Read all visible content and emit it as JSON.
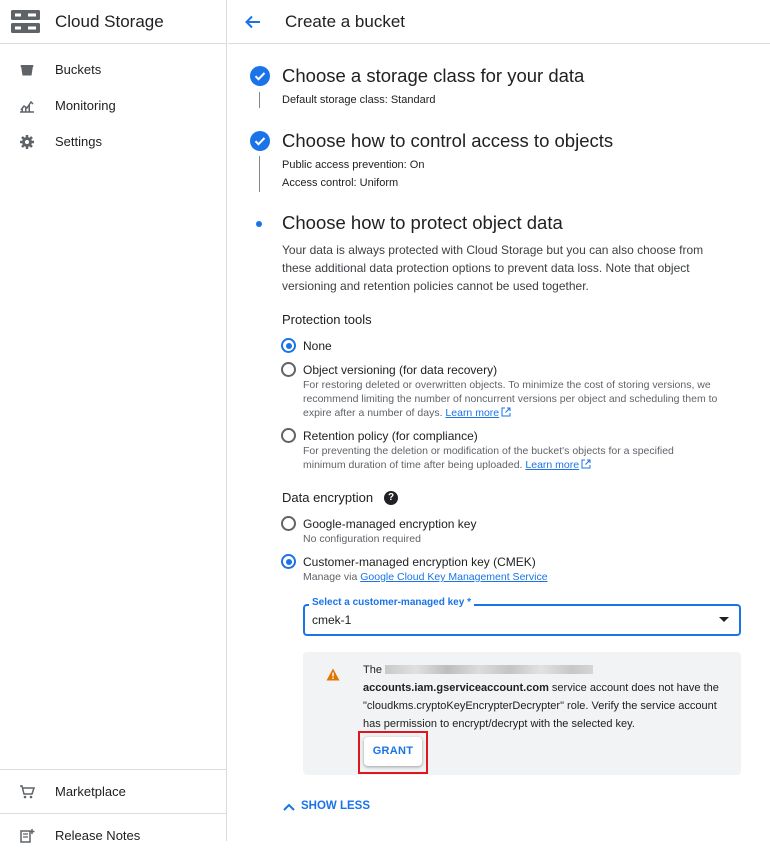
{
  "sidebar": {
    "title": "Cloud Storage",
    "items": [
      {
        "label": "Buckets"
      },
      {
        "label": "Monitoring"
      },
      {
        "label": "Settings"
      }
    ],
    "bottom_items": [
      {
        "label": "Marketplace"
      },
      {
        "label": "Release Notes"
      }
    ]
  },
  "header": {
    "title": "Create a bucket"
  },
  "steps": {
    "storage_class": {
      "title": "Choose a storage class for your data",
      "meta": [
        {
          "key": "Default storage class:",
          "value": "Standard"
        }
      ]
    },
    "access": {
      "title": "Choose how to control access to objects",
      "meta": [
        {
          "key": "Public access prevention:",
          "value": "On"
        },
        {
          "key": "Access control:",
          "value": "Uniform"
        }
      ]
    },
    "protect": {
      "title": "Choose how to protect object data",
      "description": "Your data is always protected with Cloud Storage but you can also choose from these additional data protection options to prevent data loss. Note that object versioning and retention policies cannot be used together.",
      "protection_tools": {
        "heading": "Protection tools",
        "options": [
          {
            "label": "None",
            "selected": true
          },
          {
            "label": "Object versioning (for data recovery)",
            "selected": false,
            "help": "For restoring deleted or overwritten objects. To minimize the cost of storing versions, we recommend limiting the number of noncurrent versions per object and scheduling them to expire after a number of days.",
            "link": "Learn more"
          },
          {
            "label": "Retention policy (for compliance)",
            "selected": false,
            "help": "For preventing the deletion or modification of the bucket's objects for a specified minimum duration of time after being uploaded.",
            "link": "Learn more"
          }
        ]
      },
      "encryption": {
        "heading": "Data encryption",
        "options": [
          {
            "label": "Google-managed encryption key",
            "selected": false,
            "help": "No configuration required"
          },
          {
            "label": "Customer-managed encryption key (CMEK)",
            "selected": true,
            "help": "Manage via",
            "link": "Google Cloud Key Management Service"
          }
        ],
        "select": {
          "label": "Select a customer-managed key *",
          "value": "cmek-1"
        },
        "warning": {
          "text_prefix": "The",
          "account_suffix": "accounts.iam.gserviceaccount.com",
          "text_rest": "service account does not have the \"cloudkms.cryptoKeyEncrypterDecrypter\" role. Verify the service account has permission to encrypt/decrypt with the selected key.",
          "button": "GRANT"
        }
      },
      "show_less": "SHOW LESS"
    }
  },
  "colors": {
    "accent": "#1a73e8",
    "warning": "#e37400",
    "highlight": "#e0161e"
  }
}
